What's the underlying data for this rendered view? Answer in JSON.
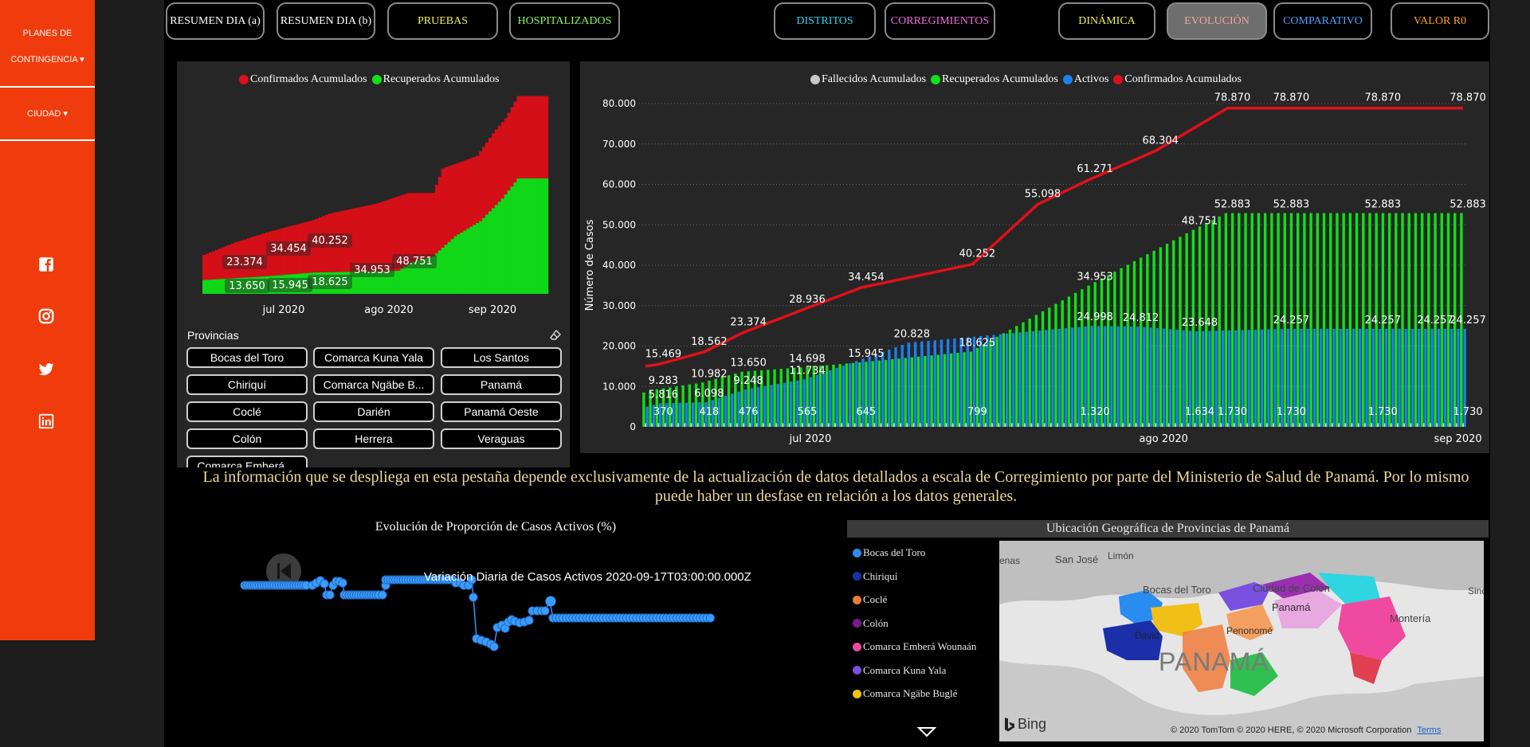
{
  "sidebar": {
    "menu1_line1": "PLANES DE",
    "menu1_line2": "CONTINGENCIA ▾",
    "menu2": "CIUDAD ▾",
    "icons": [
      "facebook-icon",
      "instagram-icon",
      "twitter-icon",
      "linkedin-icon"
    ]
  },
  "nav": [
    {
      "label": "RESUMEN DIA (a)",
      "color": "#ffffff"
    },
    {
      "label": "RESUMEN DIA (b)",
      "color": "#ffffff"
    },
    {
      "label": "PRUEBAS",
      "color": "#f2ee5c"
    },
    {
      "label": "HOSPITALIZADOS",
      "color": "#8cf55a"
    },
    {
      "label": "DISTRITOS",
      "color": "#2fd5f0"
    },
    {
      "label": "CORREGIMIENTOS",
      "color": "#f06ce0"
    },
    {
      "label": "DINÁMICA",
      "color": "#f2ee5c"
    },
    {
      "label": "EVOLUCIÓN",
      "color": "#f5a39b"
    },
    {
      "label": "COMPARATIVO",
      "color": "#4ba3ff"
    },
    {
      "label": "VALOR R0",
      "color": "#ffa11a"
    }
  ],
  "chart_data": [
    {
      "type": "bar",
      "stacked": true,
      "title": "",
      "legend": [
        "Confirmados Acumulados",
        "Recuperados Acumulados"
      ],
      "legend_placement": "top",
      "colors": {
        "Confirmados Acumulados": "#e0101a",
        "Recuperados Acumulados": "#10e018"
      },
      "x_ticks": [
        "jul 2020",
        "ago 2020",
        "sep 2020"
      ],
      "confirmados_labels": [
        "23.374",
        "34.454",
        "40.252"
      ],
      "recuperados_labels": [
        "13.650",
        "15.945",
        "18.625",
        "34.953",
        "48.751"
      ],
      "ylim": [
        0,
        80000
      ]
    },
    {
      "type": "bar",
      "title": "",
      "ylabel": "Número de Casos",
      "ylim": [
        0,
        80000
      ],
      "y_ticks": [
        "0",
        "10.000",
        "20.000",
        "30.000",
        "40.000",
        "50.000",
        "60.000",
        "70.000",
        "80.000"
      ],
      "x_ticks": [
        "jul 2020",
        "ago 2020",
        "sep 2020"
      ],
      "legend": [
        "Fallecidos Acumulados",
        "Recuperados Acumulados",
        "Activos",
        "Confirmados Acumulados"
      ],
      "legend_placement": "top",
      "colors": {
        "Fallecidos": "#c8c8c8",
        "Recuperados": "#10e018",
        "Activos": "#1e7ff0",
        "Confirmados": "#e0101a"
      },
      "confirmados_labels": [
        {
          "day": 2,
          "value": 15469,
          "label": "15.469"
        },
        {
          "day": 9,
          "value": 18562,
          "label": "18.562"
        },
        {
          "day": 15,
          "value": 23374,
          "label": "23.374"
        },
        {
          "day": 24,
          "value": 28936,
          "label": "28.936"
        },
        {
          "day": 33,
          "value": 34454,
          "label": "34.454"
        },
        {
          "day": 50,
          "value": 40252,
          "label": "40.252"
        },
        {
          "day": 60,
          "value": 55098,
          "label": "55.098"
        },
        {
          "day": 68,
          "value": 61271,
          "label": "61.271"
        },
        {
          "day": 78,
          "value": 68304,
          "label": "68.304"
        },
        {
          "day": 89,
          "value": 78870,
          "label": "78.870"
        },
        {
          "day": 98,
          "value": 78870,
          "label": "78.870"
        },
        {
          "day": 112,
          "value": 78870,
          "label": "78.870"
        },
        {
          "day": 125,
          "value": 78870,
          "label": "78.870"
        }
      ],
      "recuperados_labels": [
        {
          "day": 2,
          "value": 9283,
          "label": "9.283"
        },
        {
          "day": 9,
          "value": 10982,
          "label": "10.982"
        },
        {
          "day": 15,
          "value": 13650,
          "label": "13.650"
        },
        {
          "day": 24,
          "value": 14698,
          "label": "14.698"
        },
        {
          "day": 33,
          "value": 15945,
          "label": "15.945"
        },
        {
          "day": 50,
          "value": 18625,
          "label": "18.625"
        },
        {
          "day": 68,
          "value": 34953,
          "label": "34.953"
        },
        {
          "day": 84,
          "value": 48751,
          "label": "48.751"
        },
        {
          "day": 89,
          "value": 52883,
          "label": "52.883"
        },
        {
          "day": 98,
          "value": 52883,
          "label": "52.883"
        },
        {
          "day": 112,
          "value": 52883,
          "label": "52.883"
        },
        {
          "day": 125,
          "value": 52883,
          "label": "52.883"
        }
      ],
      "activos_labels": [
        {
          "day": 2,
          "value": 5816,
          "label": "5.816"
        },
        {
          "day": 9,
          "value": 6098,
          "label": "6.098"
        },
        {
          "day": 15,
          "value": 9248,
          "label": "9.248"
        },
        {
          "day": 24,
          "value": 11734,
          "label": "11.734"
        },
        {
          "day": 40,
          "value": 20828,
          "label": "20.828"
        },
        {
          "day": 68,
          "value": 24998,
          "label": "24.998"
        },
        {
          "day": 75,
          "value": 24812,
          "label": "24.812"
        },
        {
          "day": 84,
          "value": 23648,
          "label": "23.648"
        },
        {
          "day": 98,
          "value": 24257,
          "label": "24.257"
        },
        {
          "day": 112,
          "value": 24257,
          "label": "24.257"
        },
        {
          "day": 120,
          "value": 24257,
          "label": "24.257"
        },
        {
          "day": 125,
          "value": 24257,
          "label": "24.257"
        }
      ],
      "fallecidos_labels": [
        {
          "day": 2,
          "label": "370"
        },
        {
          "day": 9,
          "label": "418"
        },
        {
          "day": 15,
          "label": "476"
        },
        {
          "day": 24,
          "label": "565"
        },
        {
          "day": 33,
          "label": "645"
        },
        {
          "day": 50,
          "label": "799"
        },
        {
          "day": 68,
          "label": "1.320"
        },
        {
          "day": 84,
          "label": "1.634"
        },
        {
          "day": 89,
          "label": "1.730"
        },
        {
          "day": 98,
          "label": "1.730"
        },
        {
          "day": 112,
          "label": "1.730"
        },
        {
          "day": 125,
          "label": "1.730"
        }
      ]
    },
    {
      "type": "line",
      "title": "Evolución de Proporción de Casos Activos (%)",
      "annotation": "Variación Diaria de Casos Activos 2020-09-17T03:00:00.000Z",
      "color": "#3a9bff"
    }
  ],
  "provincias": {
    "title": "Provincias",
    "items": [
      "Bocas del Toro",
      "Comarca Kuna Yala",
      "Los Santos",
      "Chiriquí",
      "Comarca Ngäbe B...",
      "Panamá",
      "Coclé",
      "Darién",
      "Panamá Oeste",
      "Colón",
      "Herrera",
      "Veraguas",
      "Comarca Emberá ..."
    ]
  },
  "info_text": "La información que se despliega en esta pestaña depende exclusivamente de la actualización de datos detallados a escala de Corregimiento por parte del Ministerio de Salud de Panamá. Por lo mismo puede haber un desfase en relación a los datos generales.",
  "map": {
    "title": "Ubicación Geográfica de Provincias de Panamá",
    "legend": [
      {
        "name": "Bocas del Toro",
        "color": "#2b8cf0"
      },
      {
        "name": "Chiriquí",
        "color": "#1a2fa8"
      },
      {
        "name": "Coclé",
        "color": "#f07a3a"
      },
      {
        "name": "Colón",
        "color": "#7a1a90"
      },
      {
        "name": "Comarca Emberá Wounaán",
        "color": "#f04aa0"
      },
      {
        "name": "Comarca Kuna Yala",
        "color": "#7a50e0"
      },
      {
        "name": "Comarca Ngäbe Buglé",
        "color": "#f0c018"
      }
    ],
    "labels": {
      "san_jose": "San José",
      "limon": "Limón",
      "bocas": "Bocas del Toro",
      "colon": "Ciudad de Colón",
      "panama": "Panamá",
      "penonome": "Penonomé",
      "david": "David",
      "monteria": "Montería",
      "country": "PANAMÁ",
      "enas": "enas",
      "sinc": "Sinc"
    },
    "bing": "Bing",
    "copyright": "© 2020 TomTom © 2020 HERE, © 2020 Microsoft Corporation",
    "terms": "Terms"
  }
}
